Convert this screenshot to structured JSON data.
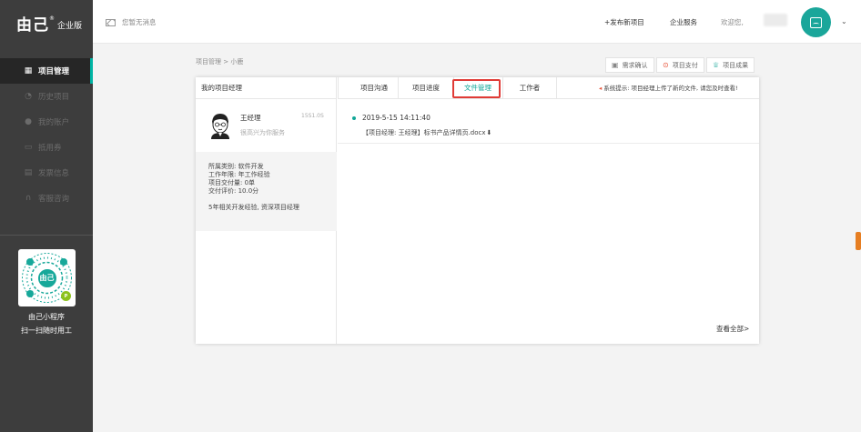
{
  "brand": {
    "name": "由己",
    "tag": "企业版"
  },
  "sidebar": {
    "items": [
      {
        "label": "项目管理",
        "icon": "grid-icon",
        "active": true
      },
      {
        "label": "历史项目",
        "icon": "clock-icon"
      },
      {
        "label": "我的账户",
        "icon": "user-icon"
      },
      {
        "label": "抵用券",
        "icon": "ticket-icon"
      },
      {
        "label": "发票信息",
        "icon": "invoice-icon"
      },
      {
        "label": "客服咨询",
        "icon": "headset-icon"
      }
    ],
    "qr": {
      "center": "由己",
      "badge": "P",
      "caption1": "由己小程序",
      "caption2": "扫一扫随时用工"
    }
  },
  "header": {
    "message": "您暂无消息",
    "publish": "+发布新项目",
    "enterprise_service": "企业服务",
    "welcome": "欢迎您,"
  },
  "breadcrumb": "项目管理 > 小鹿",
  "actions": [
    {
      "label": "需求确认",
      "icon": "doc-check-icon"
    },
    {
      "label": "项目支付",
      "icon": "yen-icon"
    },
    {
      "label": "项目成果",
      "icon": "trophy-icon"
    }
  ],
  "manager_panel": {
    "title": "我的项目经理",
    "name": "王经理",
    "id": "15S1.0S",
    "subtitle": "很高兴为你服务",
    "info": [
      "所属类别: 软件开发",
      "工作年限: 年工作经验",
      "项目交付量: 0单",
      "交付评价: 10.0分"
    ],
    "description": "5年相关开发经验, 资深项目经理"
  },
  "tabs": [
    {
      "label": "项目沟通"
    },
    {
      "label": "项目进度"
    },
    {
      "label": "文件管理",
      "active": true
    },
    {
      "label": "工作者"
    }
  ],
  "hint": "系统提示: 项目经理上传了新的文件, 请您及时查看!",
  "file_entry": {
    "date": "2019-5-15 14:11:40",
    "file": "【项目经理: 王经理】标书产品详情页.docx"
  },
  "view_all": "查看全部>",
  "colors": {
    "accent": "#0fa697",
    "sidebar": "#3d3d3d",
    "highlight": "#e03b36"
  }
}
